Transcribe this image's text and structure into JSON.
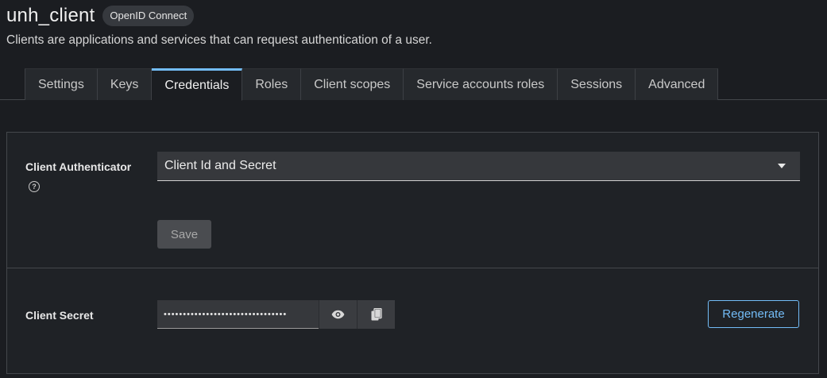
{
  "header": {
    "title": "unh_client",
    "protocol_badge": "OpenID Connect",
    "subtitle": "Clients are applications and services that can request authentication of a user."
  },
  "tabs": [
    {
      "label": "Settings",
      "active": false
    },
    {
      "label": "Keys",
      "active": false
    },
    {
      "label": "Credentials",
      "active": true
    },
    {
      "label": "Roles",
      "active": false
    },
    {
      "label": "Client scopes",
      "active": false
    },
    {
      "label": "Service accounts roles",
      "active": false
    },
    {
      "label": "Sessions",
      "active": false
    },
    {
      "label": "Advanced",
      "active": false
    }
  ],
  "authenticator": {
    "label": "Client Authenticator",
    "help_icon": "question-circle-icon",
    "selected_value": "Client Id and Secret",
    "save_label": "Save"
  },
  "secret": {
    "label": "Client Secret",
    "masked_value": "••••••••••••••••••••••••••••••••",
    "show_icon": "eye-icon",
    "copy_icon": "copy-icon",
    "regenerate_label": "Regenerate"
  },
  "colors": {
    "accent": "#73bcf7",
    "background": "#1b1d21"
  }
}
